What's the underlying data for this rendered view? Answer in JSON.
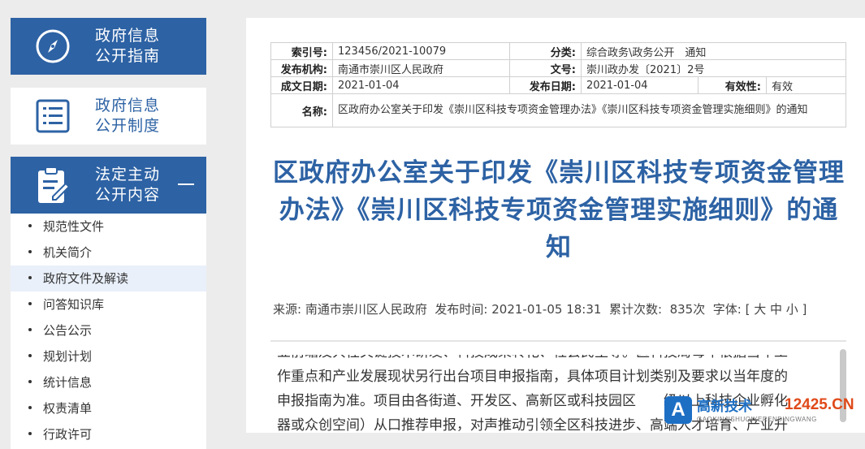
{
  "sidebar": {
    "blocks": [
      {
        "label_line1": "政府信息",
        "label_line2": "公开指南",
        "icon": "compass-icon"
      },
      {
        "label_line1": "政府信息",
        "label_line2": "公开制度",
        "icon": "list-document-icon"
      },
      {
        "label_line1": "法定主动",
        "label_line2": "公开内容",
        "icon": "clipboard-edit-icon"
      }
    ],
    "items": [
      {
        "label": "规范性文件"
      },
      {
        "label": "机关简介"
      },
      {
        "label": "政府文件及解读"
      },
      {
        "label": "问答知识库"
      },
      {
        "label": "公告公示"
      },
      {
        "label": "规划计划"
      },
      {
        "label": "统计信息"
      },
      {
        "label": "权责清单"
      },
      {
        "label": "行政许可"
      }
    ],
    "active_index": 2,
    "colors": {
      "blue": "#2d62a4",
      "active_bg": "#e9f0fa"
    }
  },
  "meta": {
    "index_no_label": "索引号:",
    "index_no": "123456/2021-10079",
    "category_label": "分类:",
    "category": "综合政务\\政务公开　通知",
    "publisher_label": "发布机构:",
    "publisher": "南通市崇川区人民政府",
    "doc_no_label": "文号:",
    "doc_no": "崇川政办发〔2021〕2号",
    "created_label": "成文日期:",
    "created": "2021-01-04",
    "published_label": "发布日期:",
    "published": "2021-01-04",
    "validity_label": "有效性:",
    "validity": "有效",
    "name_label": "名称:",
    "name": "区政府办公室关于印发《崇川区科技专项资金管理办法》《崇川区科技专项资金管理实施细则》的通知"
  },
  "article": {
    "title": "区政府办公室关于印发《崇川区科技专项资金管理办法》《崇川区科技专项资金管理实施细则》的通知",
    "source_label": "来源:",
    "source": "南通市崇川区人民政府",
    "time_label": "发布时间:",
    "time": "2021-01-05 18:31",
    "views_label": "累计次数:",
    "views": "835次",
    "font_label": "字体:",
    "font_controls": "[ 大 中 小 ]",
    "body_lines": [
      "业前瞻及共性关键技术研发、科技成果转化、社会民生等。区科技局每年根据当年工",
      "作重点和产业发展现状另行出台项目申报指南，具体项目计划类别及要求以当年度的",
      "申报指南为准。项目由各街道、开发区、高新区或科技园区　　级以上科技企业孵化",
      "器或众创空间）从口推荐申报，对声推动引领全区科技进步、高端人才培育、产业升"
    ]
  },
  "watermark": {
    "letter": "A",
    "text_cn": "高新技术",
    "text_domain": "12425.CN",
    "text_pinyin": "GAOXINJISHUQIYERENDINGWANG"
  }
}
